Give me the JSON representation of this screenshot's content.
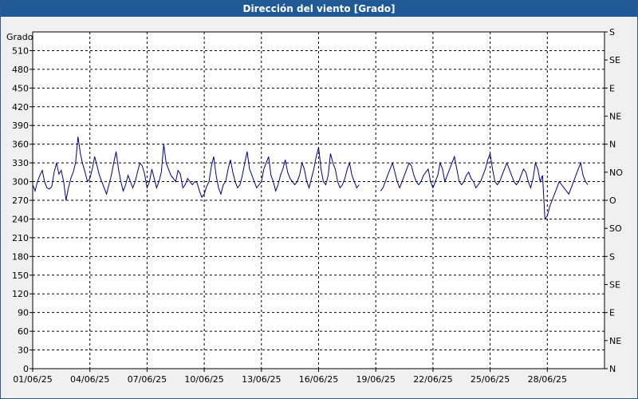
{
  "window": {
    "title": "Dirección del viento [Grado]"
  },
  "chart_data": {
    "type": "line",
    "title": "Dirección del viento [Grado]",
    "ylabel": "Grado",
    "ylim": [
      0,
      540
    ],
    "y_ticks": [
      0,
      30,
      60,
      90,
      120,
      150,
      180,
      210,
      240,
      270,
      300,
      330,
      360,
      390,
      420,
      450,
      480,
      510
    ],
    "y_tick_labels": [
      "0",
      "30",
      "60",
      "90",
      "120",
      "150",
      "180",
      "210",
      "240",
      "270",
      "300",
      "330",
      "360",
      "390",
      "420",
      "450",
      "480",
      "510"
    ],
    "right_axis_labels": [
      {
        "value": 0,
        "label": "N"
      },
      {
        "value": 45,
        "label": "NE"
      },
      {
        "value": 90,
        "label": "E"
      },
      {
        "value": 135,
        "label": "SE"
      },
      {
        "value": 180,
        "label": "S"
      },
      {
        "value": 225,
        "label": "SO"
      },
      {
        "value": 270,
        "label": "O"
      },
      {
        "value": 315,
        "label": "NO"
      },
      {
        "value": 360,
        "label": "N"
      },
      {
        "value": 405,
        "label": "NE"
      },
      {
        "value": 450,
        "label": "E"
      },
      {
        "value": 495,
        "label": "SE"
      },
      {
        "value": 540,
        "label": "S"
      }
    ],
    "x_tick_labels": [
      "01/06/25",
      "04/06/25",
      "07/06/25",
      "10/06/25",
      "13/06/25",
      "16/06/25",
      "19/06/25",
      "22/06/25",
      "25/06/25",
      "28/06/25"
    ],
    "x_range_days": [
      0,
      30
    ],
    "grid": true,
    "color": "#00008b",
    "series": [
      {
        "x_step_days": 0.125,
        "values": [
          295,
          285,
          300,
          310,
          318,
          300,
          290,
          288,
          292,
          315,
          330,
          312,
          318,
          300,
          270,
          290,
          305,
          315,
          330,
          372,
          345,
          328,
          315,
          300,
          305,
          320,
          340,
          325,
          310,
          300,
          290,
          280,
          295,
          310,
          330,
          348,
          320,
          300,
          285,
          295,
          310,
          300,
          290,
          300,
          315,
          330,
          325,
          312,
          290,
          300,
          320,
          305,
          290,
          300,
          315,
          360,
          330,
          320,
          310,
          305,
          300,
          318,
          312,
          290,
          295,
          305,
          300,
          295,
          300,
          298,
          285,
          275,
          280,
          292,
          300,
          325,
          340,
          310,
          290,
          280,
          295,
          300,
          320,
          335,
          315,
          300,
          290,
          295,
          310,
          330,
          348,
          320,
          310,
          300,
          290,
          295,
          300,
          320,
          330,
          340,
          310,
          300,
          285,
          295,
          310,
          320,
          335,
          315,
          305,
          300,
          295,
          300,
          310,
          330,
          320,
          300,
          290,
          305,
          320,
          340,
          355,
          320,
          300,
          295,
          310,
          345,
          330,
          320,
          300,
          290,
          295,
          305,
          320,
          330,
          310,
          300,
          290,
          295,
          null,
          null,
          null,
          null,
          null,
          null,
          null,
          null,
          285,
          290,
          300,
          310,
          320,
          330,
          315,
          300,
          290,
          300,
          310,
          320,
          330,
          325,
          310,
          300,
          295,
          300,
          310,
          315,
          320,
          300,
          290,
          300,
          310,
          330,
          320,
          300,
          310,
          320,
          330,
          340,
          320,
          300,
          295,
          300,
          310,
          315,
          305,
          300,
          290,
          295,
          300,
          310,
          320,
          335,
          345,
          320,
          300,
          295,
          300,
          310,
          320,
          330,
          320,
          310,
          300,
          295,
          300,
          310,
          320,
          315,
          300,
          290,
          305,
          330,
          320,
          300,
          310,
          240,
          245,
          260,
          270,
          280,
          290,
          300,
          295,
          290,
          285,
          280,
          290,
          300,
          310,
          320,
          330,
          310,
          300,
          295
        ]
      }
    ]
  }
}
